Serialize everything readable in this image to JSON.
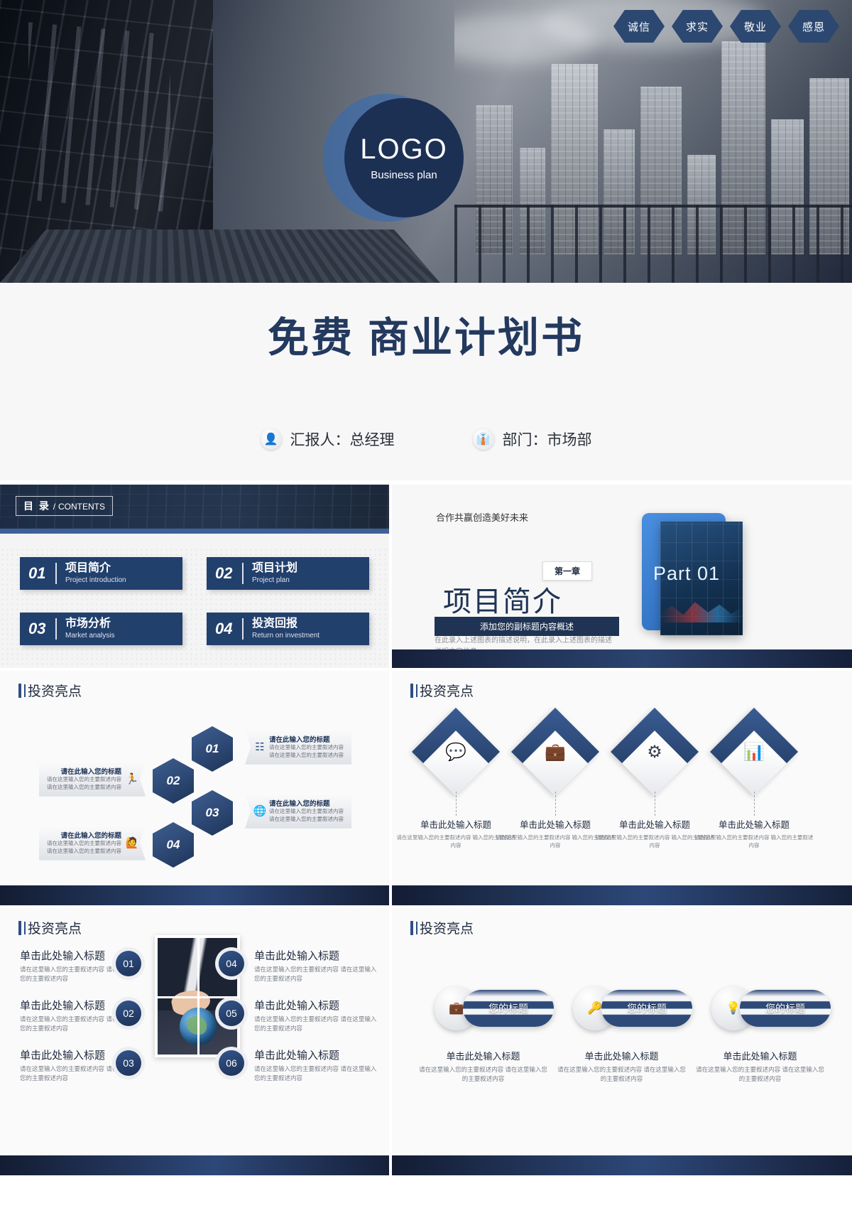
{
  "cover": {
    "hex_badges": [
      "诚信",
      "求实",
      "敬业",
      "感恩"
    ],
    "logo_main": "LOGO",
    "logo_sub": "Business plan",
    "title": "免费 商业计划书",
    "presenter": "汇报人：总经理",
    "presenter_icon": "person-icon",
    "department": "部门：市场部",
    "department_icon": "necktie-icon"
  },
  "contents": {
    "badge_cn": "目 录",
    "badge_sep": "/",
    "badge_en": "CONTENTS",
    "items": [
      {
        "num": "01",
        "cn": "项目简介",
        "en": "Project introduction"
      },
      {
        "num": "02",
        "cn": "项目计划",
        "en": "Project plan"
      },
      {
        "num": "03",
        "cn": "市场分析",
        "en": "Market analysis"
      },
      {
        "num": "04",
        "cn": "投资回报",
        "en": "Return on investment"
      }
    ]
  },
  "section": {
    "kicker": "合作共赢创造美好未来",
    "chapter": "第一章",
    "title": "项目简介",
    "subtitle": "添加您的副标题内容概述",
    "desc": "在此录入上述图表的描述说明，在此录入上述图表的描述说明文字信息。",
    "part": "Part 01"
  },
  "slide_hex": {
    "heading": "投资亮点",
    "steps": [
      {
        "num": "01",
        "title": "请在此输入您的标题",
        "desc": "请在这里输入您的主要叙述内容 请在这里输入您的主要叙述内容",
        "icon": "network-icon",
        "side": "right"
      },
      {
        "num": "02",
        "title": "请在此输入您的标题",
        "desc": "请在这里输入您的主要叙述内容 请在这里输入您的主要叙述内容",
        "icon": "runner-icon",
        "side": "left"
      },
      {
        "num": "03",
        "title": "请在此输入您的标题",
        "desc": "请在这里输入您的主要叙述内容 请在这里输入您的主要叙述内容",
        "icon": "globe-icon",
        "side": "right"
      },
      {
        "num": "04",
        "title": "请在此输入您的标题",
        "desc": "请在这里输入您的主要叙述内容 请在这里输入您的主要叙述内容",
        "icon": "presenter-icon",
        "side": "left"
      }
    ]
  },
  "slide_diamond": {
    "heading": "投资亮点",
    "cards": [
      {
        "icon": "chat-icon",
        "title": "单击此处输入标题",
        "desc": "请在这里输入您的主要叙述内容 输入您的主要叙述内容"
      },
      {
        "icon": "briefcase-icon",
        "title": "单击此处输入标题",
        "desc": "请在这里输入您的主要叙述内容 输入您的主要叙述内容"
      },
      {
        "icon": "gears-icon",
        "title": "单击此处输入标题",
        "desc": "请在这里输入您的主要叙述内容 输入您的主要叙述内容"
      },
      {
        "icon": "bar-chart-icon",
        "title": "单击此处输入标题",
        "desc": "请在这里输入您的主要叙述内容 输入您的主要叙述内容"
      }
    ]
  },
  "slide_numbers": {
    "heading": "投资亮点",
    "left": [
      {
        "num": "01",
        "title": "单击此处输入标题",
        "desc": "请在这里输入您的主要叙述内容 请在这里输入您的主要叙述内容"
      },
      {
        "num": "02",
        "title": "单击此处输入标题",
        "desc": "请在这里输入您的主要叙述内容 请在这里输入您的主要叙述内容"
      },
      {
        "num": "03",
        "title": "单击此处输入标题",
        "desc": "请在这里输入您的主要叙述内容 请在这里输入您的主要叙述内容"
      }
    ],
    "right": [
      {
        "num": "04",
        "title": "单击此处输入标题",
        "desc": "请在这里输入您的主要叙述内容 请在这里输入您的主要叙述内容"
      },
      {
        "num": "05",
        "title": "单击此处输入标题",
        "desc": "请在这里输入您的主要叙述内容 请在这里输入您的主要叙述内容"
      },
      {
        "num": "06",
        "title": "单击此处输入标题",
        "desc": "请在这里输入您的主要叙述内容 请在这里输入您的主要叙述内容"
      }
    ]
  },
  "slide_circles": {
    "heading": "投资亮点",
    "items": [
      {
        "icon": "briefcase-icon",
        "pill": "您的标题",
        "title": "单击此处输入标题",
        "desc": "请在这里输入您的主要叙述内容 请在这里输入您的主要叙述内容"
      },
      {
        "icon": "key-icon",
        "pill": "您的标题",
        "title": "单击此处输入标题",
        "desc": "请在这里输入您的主要叙述内容 请在这里输入您的主要叙述内容"
      },
      {
        "icon": "bulb-icon",
        "pill": "您的标题",
        "title": "单击此处输入标题",
        "desc": "请在这里输入您的主要叙述内容 请在这里输入您的主要叙述内容"
      }
    ]
  },
  "colors": {
    "navy": "#1f3354",
    "navy_dark": "#16203a",
    "accent_blue": "#3c6199",
    "page_bg": "#f7f7f8"
  }
}
